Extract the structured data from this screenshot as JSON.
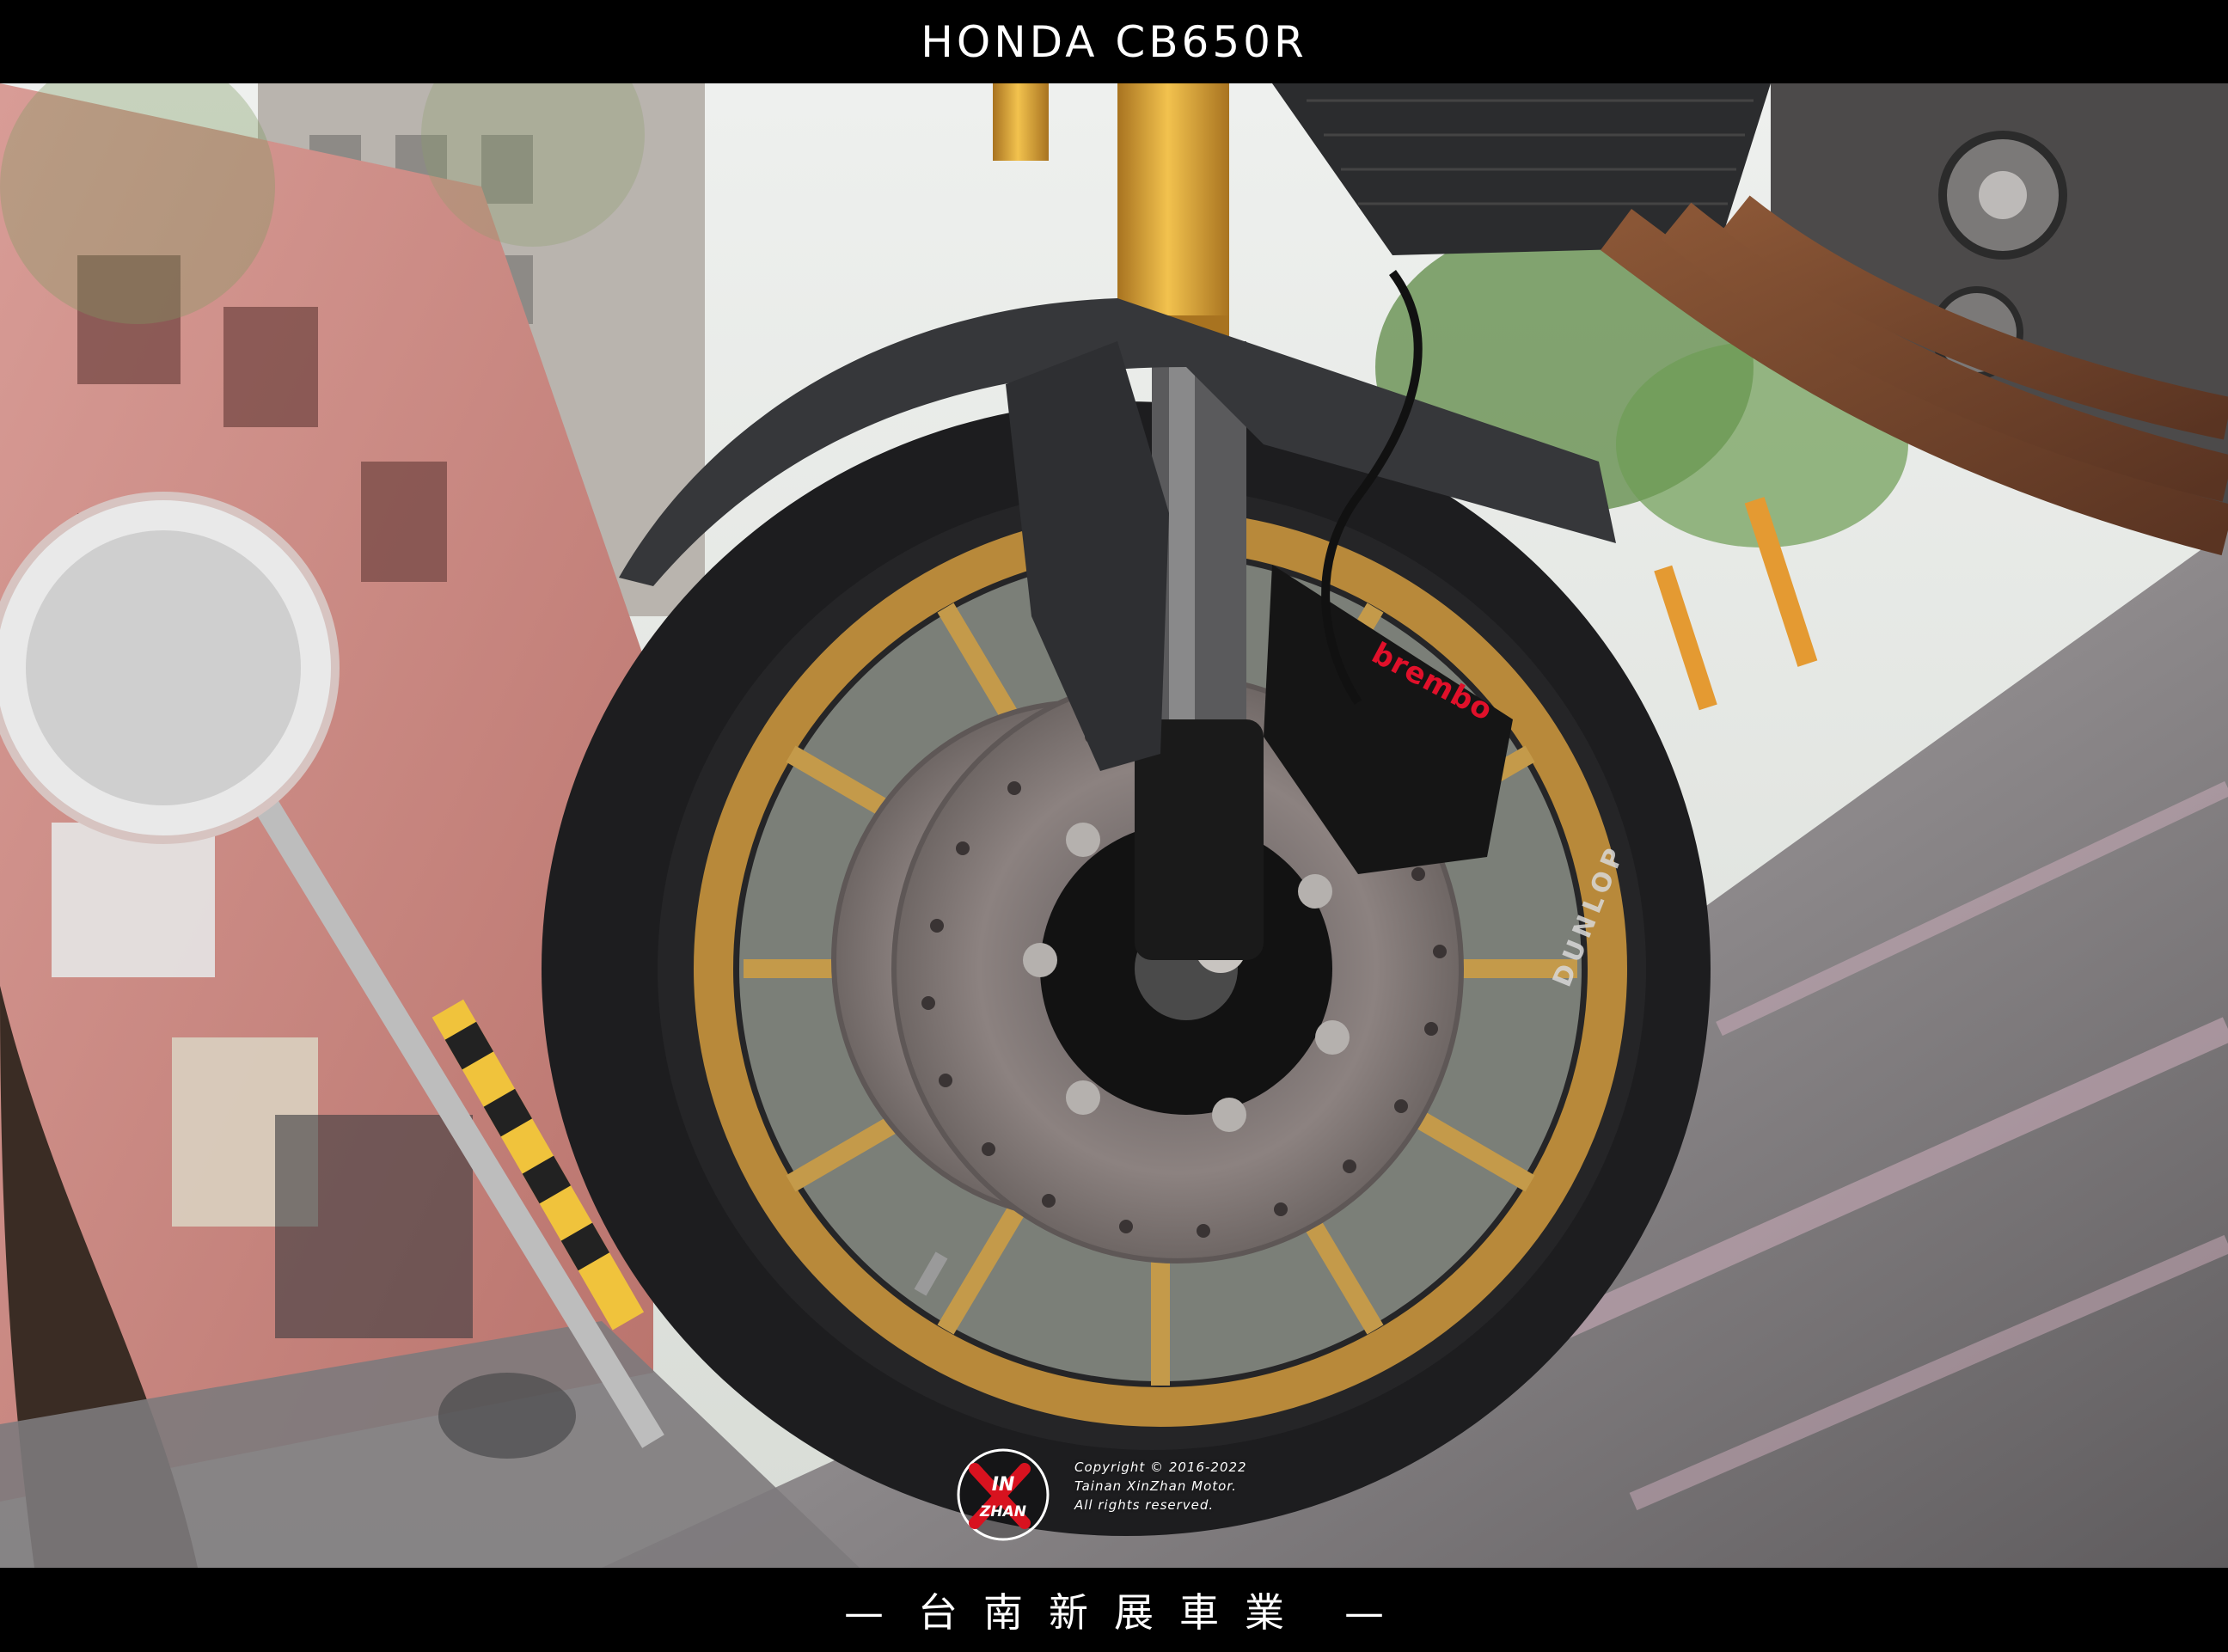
{
  "header": {
    "title": "HONDA CB650R"
  },
  "footer": {
    "dash_left": "—",
    "title": "台南新展車業",
    "dash_right": "—"
  },
  "watermark": {
    "logo_text": "XINZHAN",
    "line1": "Copyright © 2016-2022",
    "line2": "Tainan XinZhan Motor.",
    "line3": "All rights reserved."
  },
  "photo_labels": {
    "caliper_brand": "brembo",
    "tire_brand": "DUNLOP"
  },
  "colors": {
    "fork_gold": "#d9a441",
    "rim_gold": "#b8893a",
    "tire": "#1e1e1e",
    "fender": "#3a3b3e",
    "brick": "#c98a84",
    "pavement": "#8b8a8d",
    "brembo_red": "#e0102a"
  }
}
